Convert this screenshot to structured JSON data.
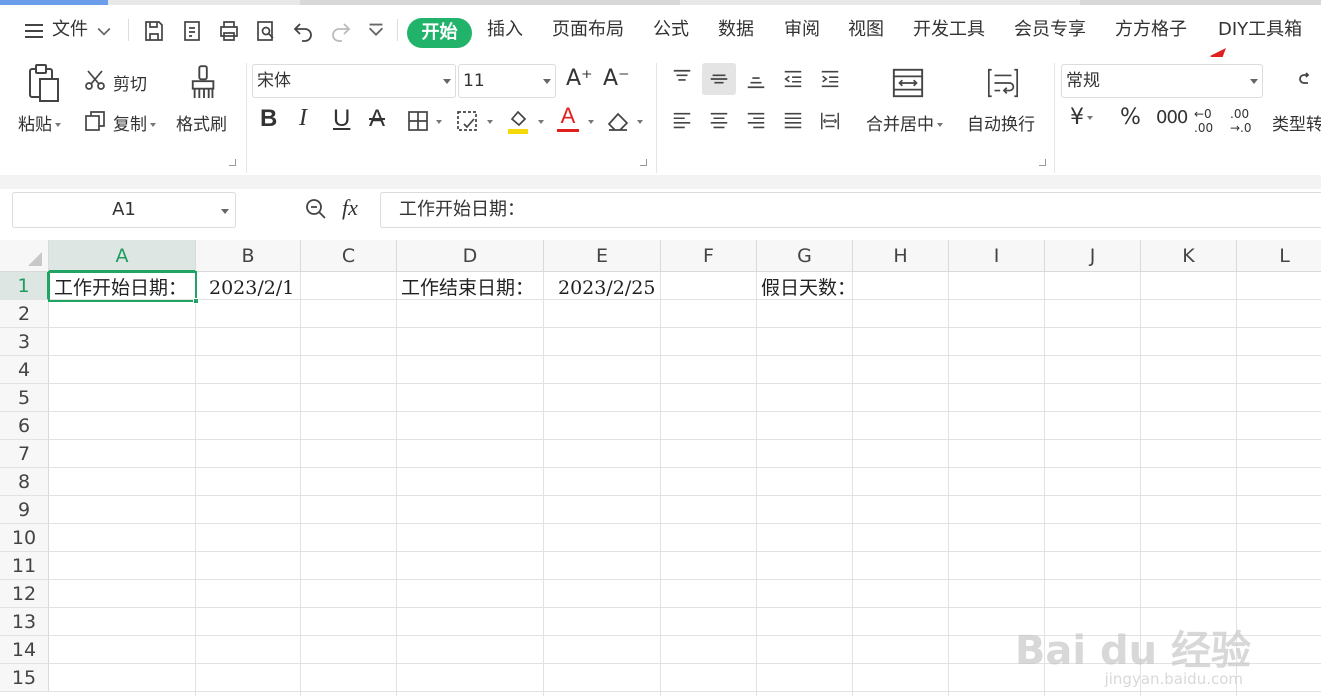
{
  "menu": {
    "file_label": "文件",
    "tabs": [
      "开始",
      "插入",
      "页面布局",
      "公式",
      "数据",
      "审阅",
      "视图",
      "开发工具",
      "会员专享",
      "方方格子",
      "DIY工具箱"
    ],
    "active_tab": "开始"
  },
  "ribbon": {
    "paste": "粘贴",
    "cut": "剪切",
    "copy": "复制",
    "format_painter": "格式刷",
    "font_name": "宋体",
    "font_size": "11",
    "merge_center": "合并居中",
    "wrap_text": "自动换行",
    "number_format": "常规",
    "type_convert": "类型转",
    "currency_symbol": "¥",
    "percent_symbol": "%",
    "thousands_symbol": "000",
    "inc_decimal": "←0 .00",
    "dec_decimal": ".00 →.0",
    "bold": "B",
    "italic": "I",
    "underline": "U",
    "font_color_glyph": "A",
    "strike_glyph": "A",
    "grow_font": "A⁺",
    "shrink_font": "A⁻",
    "colors": {
      "highlight": "#f5d90a",
      "font_color": "#e02020"
    }
  },
  "formula_bar": {
    "name_box": "A1",
    "fx": "fx",
    "content": "工作开始日期："
  },
  "sheet": {
    "columns": [
      "A",
      "B",
      "C",
      "D",
      "E",
      "F",
      "G",
      "H",
      "I",
      "J",
      "K",
      "L"
    ],
    "rows": [
      "1",
      "2",
      "3",
      "4",
      "5",
      "6",
      "7",
      "8",
      "9",
      "10",
      "11",
      "12",
      "13",
      "14",
      "15"
    ],
    "selected_cell": "A1",
    "cells": {
      "A1": "工作开始日期：",
      "B1": "2023/2/1",
      "D1": "工作结束日期：",
      "E1": "2023/2/25",
      "G1": "假日天数："
    }
  },
  "watermark": {
    "main": "Bai du 经验",
    "sub": "jingyan.baidu.com"
  },
  "accent_color": "#21b36a"
}
